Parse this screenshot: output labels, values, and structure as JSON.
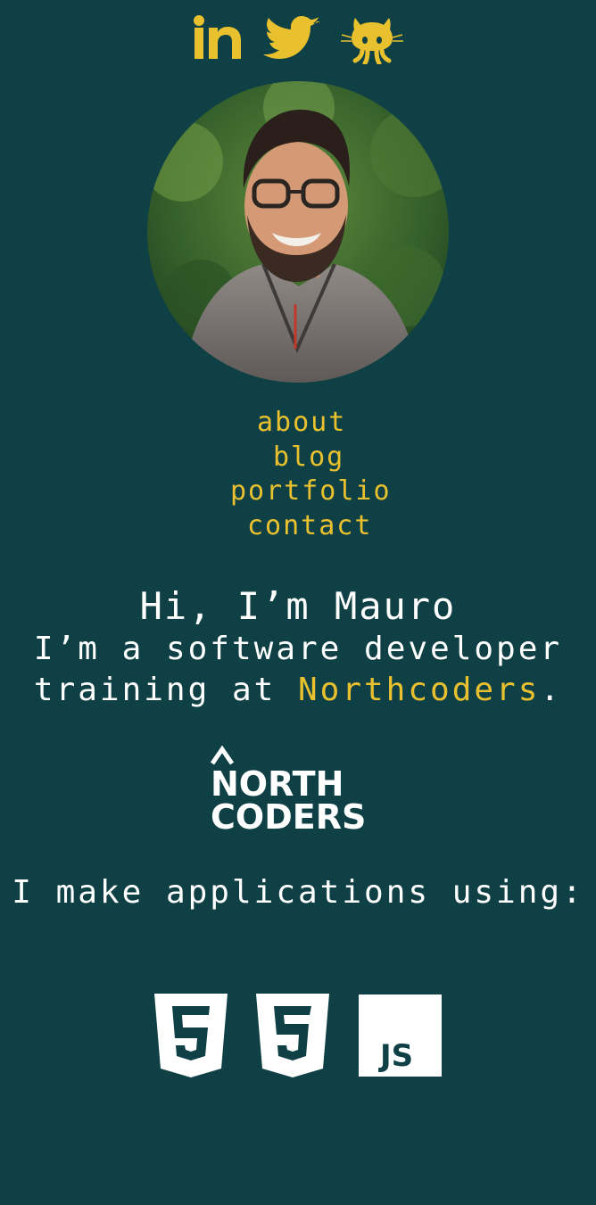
{
  "social": {
    "linkedin_icon": "linkedin-icon",
    "twitter_icon": "twitter-icon",
    "github_icon": "github-icon"
  },
  "avatar": {
    "alt": "Mauro"
  },
  "nav": {
    "about": "about",
    "blog": "blog",
    "portfolio": "portfolio",
    "contact": "contact"
  },
  "hero": {
    "greeting": "Hi, I’m Mauro",
    "line1": "I’m a software developer",
    "line2_prefix": "training at ",
    "line2_link": "Northcoders",
    "line2_suffix": "."
  },
  "northcoders_logo": {
    "word1": "NORTH",
    "word2": "CODERS"
  },
  "tools": {
    "intro": "I make applications using:",
    "icons": [
      "html5-icon",
      "css3-icon",
      "javascript-icon"
    ],
    "js_label": "JS"
  },
  "colors": {
    "background": "#0f4045",
    "accent": "#e9c12e",
    "text": "#ffffff"
  }
}
